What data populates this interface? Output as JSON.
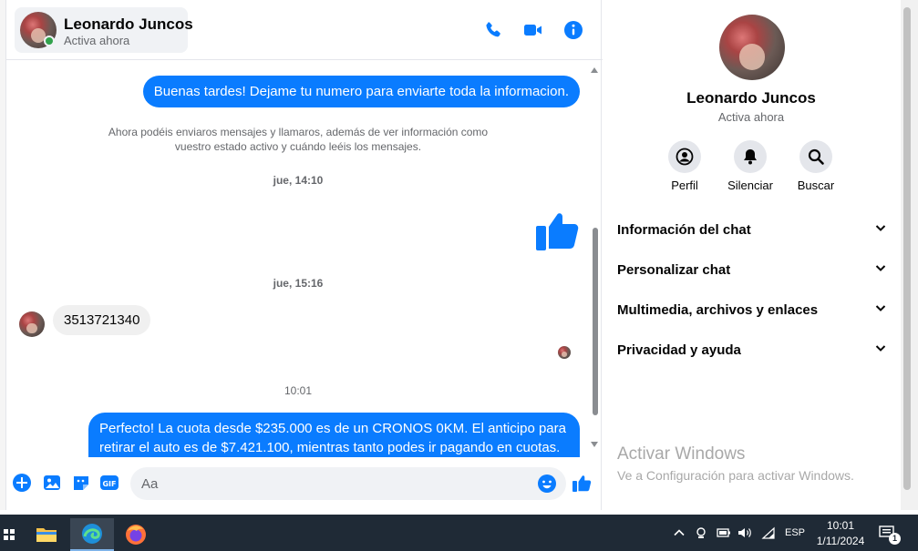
{
  "header": {
    "contact_name": "Leonardo Juncos",
    "contact_status": "Activa ahora"
  },
  "messages": {
    "out_1": "Buenas tardes! Dejame tu numero para enviarte toda la informacion.",
    "system_note_line1": "Ahora podéis enviaros mensajes y llamaros, además de ver información como",
    "system_note_line2": "vuestro estado activo y cuándo leéis los mensajes.",
    "ts_1": "jue, 14:10",
    "ts_2": "jue, 15:16",
    "in_1": "3513721340",
    "ts_3": "10:01",
    "out_2_line1": "Perfecto! La cuota desde $235.000 es de un CRONOS 0KM. El anticipo para",
    "out_2_line2": "retirar el auto es de $7.421.100, mientras tanto podes ir pagando en cuotas."
  },
  "composer": {
    "placeholder": "Aa"
  },
  "info_panel": {
    "name": "Leonardo Juncos",
    "status": "Activa ahora",
    "actions": [
      {
        "label": "Perfil",
        "icon": "profile-icon"
      },
      {
        "label": "Silenciar",
        "icon": "bell-icon"
      },
      {
        "label": "Buscar",
        "icon": "search-icon"
      }
    ],
    "sections": [
      "Información del chat",
      "Personalizar chat",
      "Multimedia, archivos y enlaces",
      "Privacidad y ayuda"
    ],
    "watermark_title": "Activar Windows",
    "watermark_text": "Ve a Configuración para activar Windows."
  },
  "taskbar": {
    "language": "ESP",
    "time": "10:01",
    "date": "1/11/2024",
    "notification_count": "1"
  },
  "colors": {
    "accent": "#0a7cff",
    "taskbar": "#1f2a36"
  }
}
